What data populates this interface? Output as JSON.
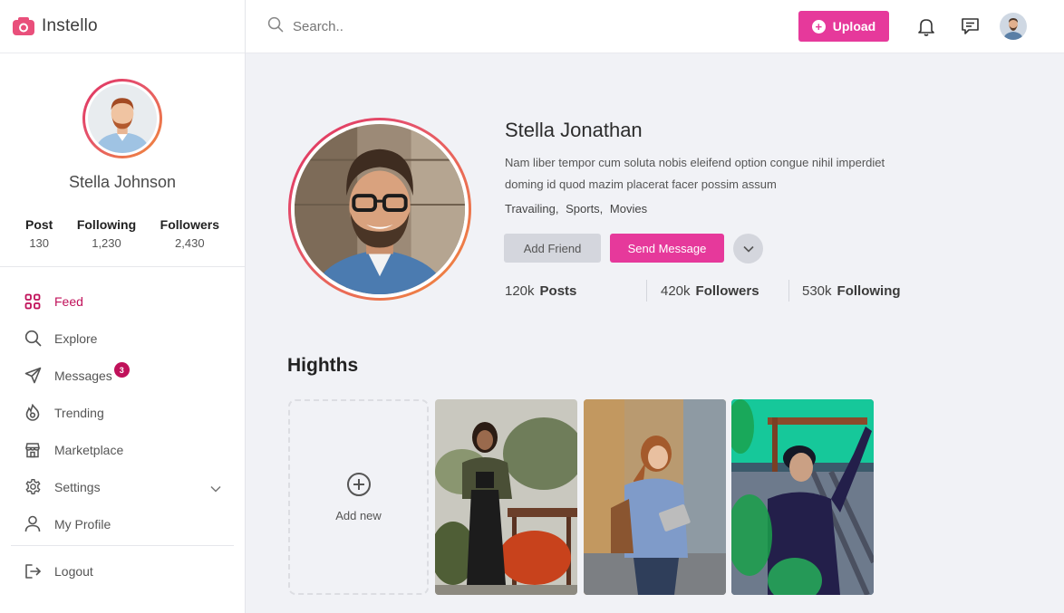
{
  "brand": {
    "name": "Instello"
  },
  "sidebar": {
    "profile": {
      "name": "Stella Johnson",
      "stats": [
        {
          "label": "Post",
          "value": "130"
        },
        {
          "label": "Following",
          "value": "1,230"
        },
        {
          "label": "Followers",
          "value": "2,430"
        }
      ]
    },
    "nav": [
      {
        "label": "Feed",
        "icon": "grid-icon",
        "active": true
      },
      {
        "label": "Explore",
        "icon": "search-icon"
      },
      {
        "label": "Messages",
        "icon": "send-icon",
        "badge": "3"
      },
      {
        "label": "Trending",
        "icon": "flame-icon"
      },
      {
        "label": "Marketplace",
        "icon": "store-icon"
      },
      {
        "label": "Settings",
        "icon": "gear-icon"
      },
      {
        "label": "My Profile",
        "icon": "user-icon"
      }
    ],
    "logout": {
      "label": "Logout",
      "icon": "logout-icon"
    }
  },
  "topbar": {
    "search_placeholder": "Search..",
    "upload_label": "Upload"
  },
  "profile": {
    "name": "Stella Jonathan",
    "bio": "Nam liber tempor cum soluta nobis eleifend option congue nihil imperdiet doming id quod mazim placerat facer possim assum",
    "tags": [
      "Travailing,",
      "Sports,",
      "Movies"
    ],
    "add_friend_label": "Add Friend",
    "send_message_label": "Send Message",
    "stats": [
      {
        "value": "120k",
        "label": "Posts"
      },
      {
        "value": "420k",
        "label": "Followers"
      },
      {
        "value": "530k",
        "label": "Following"
      }
    ]
  },
  "highlights": {
    "title": "Highths",
    "add_new_label": "Add new"
  },
  "colors": {
    "accent": "#e6399b",
    "active_nav": "#c0115a",
    "ring_start": "#e0315f",
    "ring_end": "#f08b3a"
  }
}
